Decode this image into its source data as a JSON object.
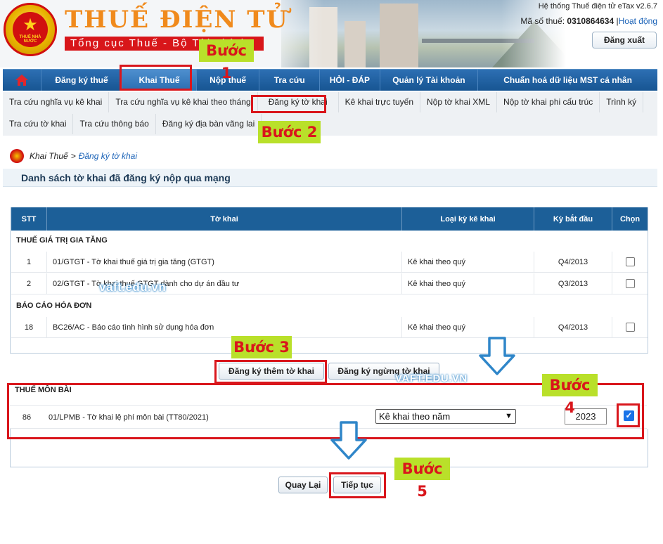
{
  "header": {
    "brand_title": "THUẾ ĐIỆN TỬ",
    "brand_subtitle": "Tổng cục Thuế - Bộ Tài chính",
    "emblem_text": "THUẾ NHÀ NƯỚC",
    "system_name": "Hệ thống Thuế điện tử eTax v2.6.7",
    "tax_code_label": "Mã số thuế:",
    "tax_code_value": "0310864634",
    "status_link": "Hoạt động",
    "logout_label": "Đăng xuất"
  },
  "topnav": {
    "items": [
      {
        "label": "Đăng ký thuế"
      },
      {
        "label": "Khai Thuế"
      },
      {
        "label": "Nộp thuế"
      },
      {
        "label": "Tra cứu"
      },
      {
        "label": "HỎI - ĐÁP"
      },
      {
        "label": "Quản lý Tài khoản"
      },
      {
        "label": "Chuẩn hoá dữ liệu MST cá nhân"
      }
    ],
    "active": "Khai Thuế"
  },
  "subnav": {
    "row1": [
      {
        "label": "Tra cứu nghĩa vụ kê khai"
      },
      {
        "label": "Tra cứu nghĩa vụ kê khai theo tháng"
      },
      {
        "label": "Đăng ký tờ khai"
      },
      {
        "label": "Kê khai trực tuyến"
      },
      {
        "label": "Nộp tờ khai XML"
      },
      {
        "label": "Nộp tờ khai phi cấu trúc"
      },
      {
        "label": "Trình ký"
      }
    ],
    "row2": [
      {
        "label": "Tra cứu tờ khai"
      },
      {
        "label": "Tra cứu thông báo"
      },
      {
        "label": "Đăng ký địa bàn vãng lai"
      }
    ]
  },
  "breadcrumb": {
    "parent": "Khai Thuế",
    "separator": ">",
    "current": "Đăng ký tờ khai"
  },
  "section_title": "Danh sách tờ khai đã đăng ký nộp qua mạng",
  "table": {
    "headers": {
      "stt": "STT",
      "form": "Tờ khai",
      "period_type": "Loại kỳ kê khai",
      "start_period": "Kỳ bắt đầu",
      "select": "Chọn"
    },
    "group1": "THUẾ GIÁ TRỊ GIA TĂNG",
    "group2": "BÁO CÁO HÓA ĐƠN",
    "rows": [
      {
        "stt": "1",
        "form": "01/GTGT - Tờ khai thuế giá trị gia tăng (GTGT)",
        "period_type": "Kê khai theo quý",
        "start": "Q4/2013"
      },
      {
        "stt": "2",
        "form": "02/GTGT - Tờ khai thuế GTGT dành cho dự án đầu tư",
        "period_type": "Kê khai theo quý",
        "start": "Q3/2013"
      },
      {
        "stt": "18",
        "form": "BC26/AC - Báo cáo tình hình sử dụng hóa đơn",
        "period_type": "Kê khai theo quý",
        "start": "Q4/2013"
      }
    ]
  },
  "actions": {
    "register_more": "Đăng ký thêm tờ khai",
    "register_stop": "Đăng ký ngừng tờ khai",
    "back": "Quay Lại",
    "continue": "Tiếp tục"
  },
  "mon_bai": {
    "group": "THUẾ MÔN BÀI",
    "stt": "86",
    "form": "01/LPMB - Tờ khai lệ phí môn bài (TT80/2021)",
    "period_select": "Kê khai theo năm",
    "year": "2023",
    "checked": true
  },
  "annotations": {
    "step1": "Bước 1",
    "step2": "Bước 2",
    "step3": "Bước 3",
    "step4": "Bước 4",
    "step5": "Bước 5",
    "watermark1": "vaft.edu.vn",
    "watermark2": "VAFT.EDU.VN"
  },
  "colors": {
    "nav_blue": "#175592",
    "brand_orange": "#f08a1c",
    "annotation_red": "#d9161c",
    "step_green": "#b9e02a",
    "arrow_blue": "#2f86c9"
  }
}
